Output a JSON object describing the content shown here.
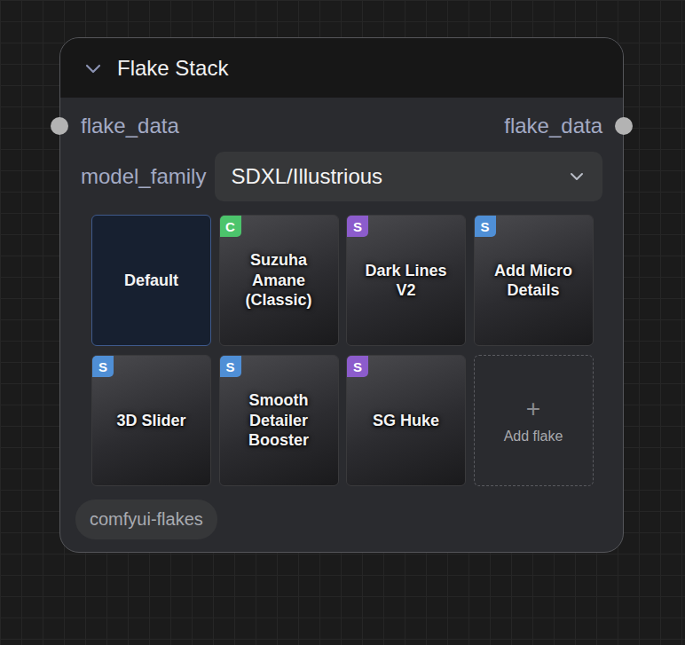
{
  "node": {
    "title": "Flake Stack"
  },
  "input": {
    "label": "flake_data"
  },
  "output": {
    "label": "flake_data"
  },
  "model_family": {
    "label": "model_family",
    "value": "SDXL/Illustrious"
  },
  "flakes": [
    {
      "kind": "default",
      "label": "Default",
      "selected": true
    },
    {
      "kind": "flake",
      "label": "Suzuha Amane (Classic)",
      "badge": "C",
      "color": "#4cc46c",
      "selected": false
    },
    {
      "kind": "flake",
      "label": "Dark Lines V2",
      "badge": "S",
      "color": "#8c5ccc",
      "selected": false
    },
    {
      "kind": "flake",
      "label": "Add Micro Details",
      "badge": "S",
      "color": "#4f8fd6",
      "selected": false
    },
    {
      "kind": "flake",
      "label": "3D Slider",
      "badge": "S",
      "color": "#4f8fd6",
      "selected": false
    },
    {
      "kind": "flake",
      "label": "Smooth Detailer Booster",
      "badge": "S",
      "color": "#4f8fd6",
      "selected": false
    },
    {
      "kind": "flake",
      "label": "SG Huke",
      "badge": "S",
      "color": "#8c5ccc",
      "selected": false
    },
    {
      "kind": "add",
      "icon": "+",
      "label": "Add flake",
      "selected": false
    }
  ],
  "footer": {
    "label": "comfyui-flakes"
  }
}
